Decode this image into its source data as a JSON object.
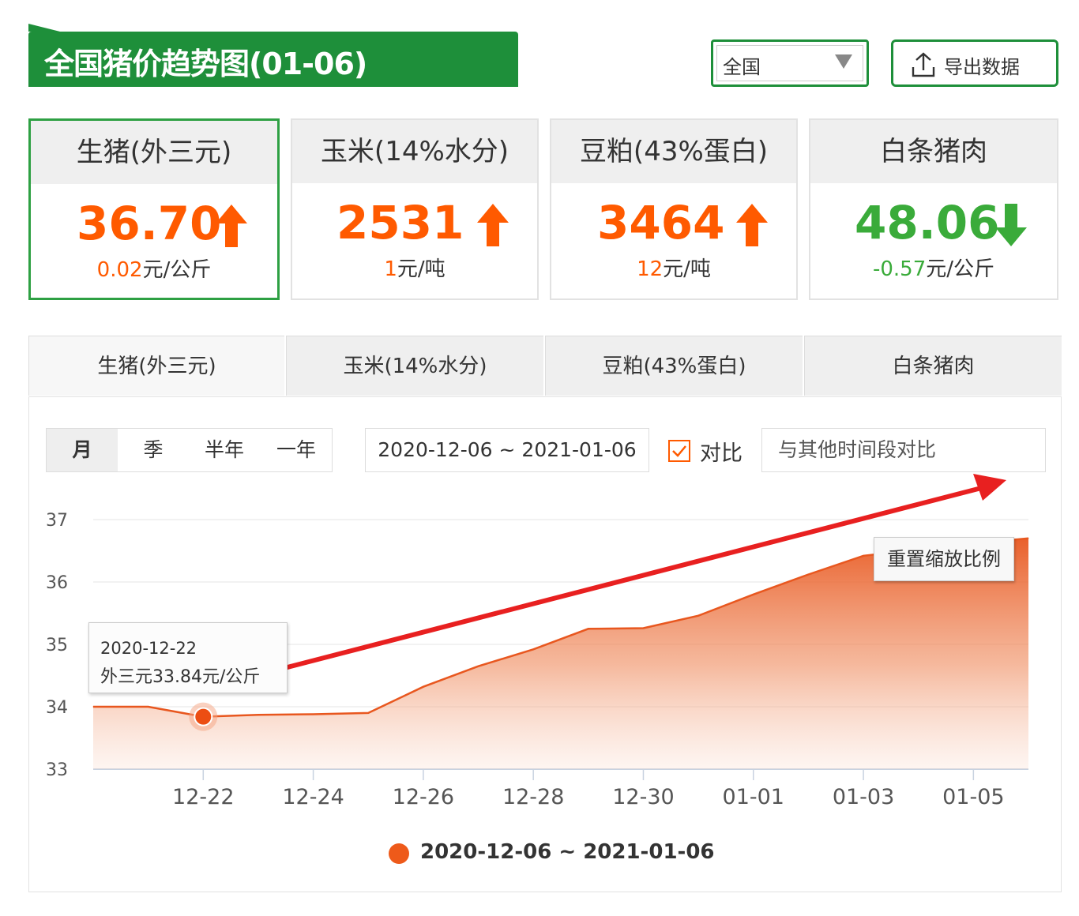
{
  "header": {
    "title": "全国猪价趋势图(01-06)",
    "region": "全国",
    "export_label": "导出数据"
  },
  "cards": [
    {
      "name": "生猪(外三元)",
      "value": "36.70",
      "delta_num": "0.02",
      "delta_unit": "元/公斤",
      "trend": "up"
    },
    {
      "name": "玉米(14%水分)",
      "value": "2531",
      "delta_num": "1",
      "delta_unit": "元/吨",
      "trend": "up"
    },
    {
      "name": "豆粕(43%蛋白)",
      "value": "3464",
      "delta_num": "12",
      "delta_unit": "元/吨",
      "trend": "up"
    },
    {
      "name": "白条猪肉",
      "value": "48.06",
      "delta_num": "-0.57",
      "delta_unit": "元/公斤",
      "trend": "down"
    }
  ],
  "tabs": [
    "生猪(外三元)",
    "玉米(14%水分)",
    "豆粕(43%蛋白)",
    "白条猪肉"
  ],
  "controls": {
    "ranges": [
      "月",
      "季",
      "半年",
      "一年"
    ],
    "date_range": "2020-12-06 ~ 2021-01-06",
    "compare_label": "对比",
    "compare_placeholder": "与其他时间段对比",
    "reset_zoom": "重置缩放比例"
  },
  "tooltip": {
    "date": "2020-12-22",
    "text": "外三元33.84元/公斤"
  },
  "colors": {
    "brand_green": "#1e8f3a",
    "up_orange": "#ff5a00",
    "down_green": "#3aab3a",
    "series": "#ee5a1a",
    "annotation_arrow": "#e82020"
  },
  "chart_data": {
    "type": "area",
    "x": [
      "12-20",
      "12-21",
      "12-22",
      "12-23",
      "12-24",
      "12-25",
      "12-26",
      "12-27",
      "12-28",
      "12-29",
      "12-30",
      "12-31",
      "01-01",
      "01-02",
      "01-03",
      "01-04",
      "01-05",
      "01-06"
    ],
    "xticks": [
      "12-22",
      "12-24",
      "12-26",
      "12-28",
      "12-30",
      "01-01",
      "01-03",
      "01-05"
    ],
    "series": [
      {
        "name": "2020-12-06 ~ 2021-01-06",
        "values": [
          34.0,
          34.0,
          33.84,
          33.87,
          33.88,
          33.9,
          34.32,
          34.65,
          34.92,
          35.25,
          35.26,
          35.46,
          35.8,
          36.12,
          36.42,
          36.52,
          36.62,
          36.7
        ]
      }
    ],
    "yticks": [
      33,
      34,
      35,
      36,
      37
    ],
    "ylim": [
      33,
      37
    ],
    "highlight_index": 2,
    "grid": true,
    "legend": "bottom-center"
  }
}
